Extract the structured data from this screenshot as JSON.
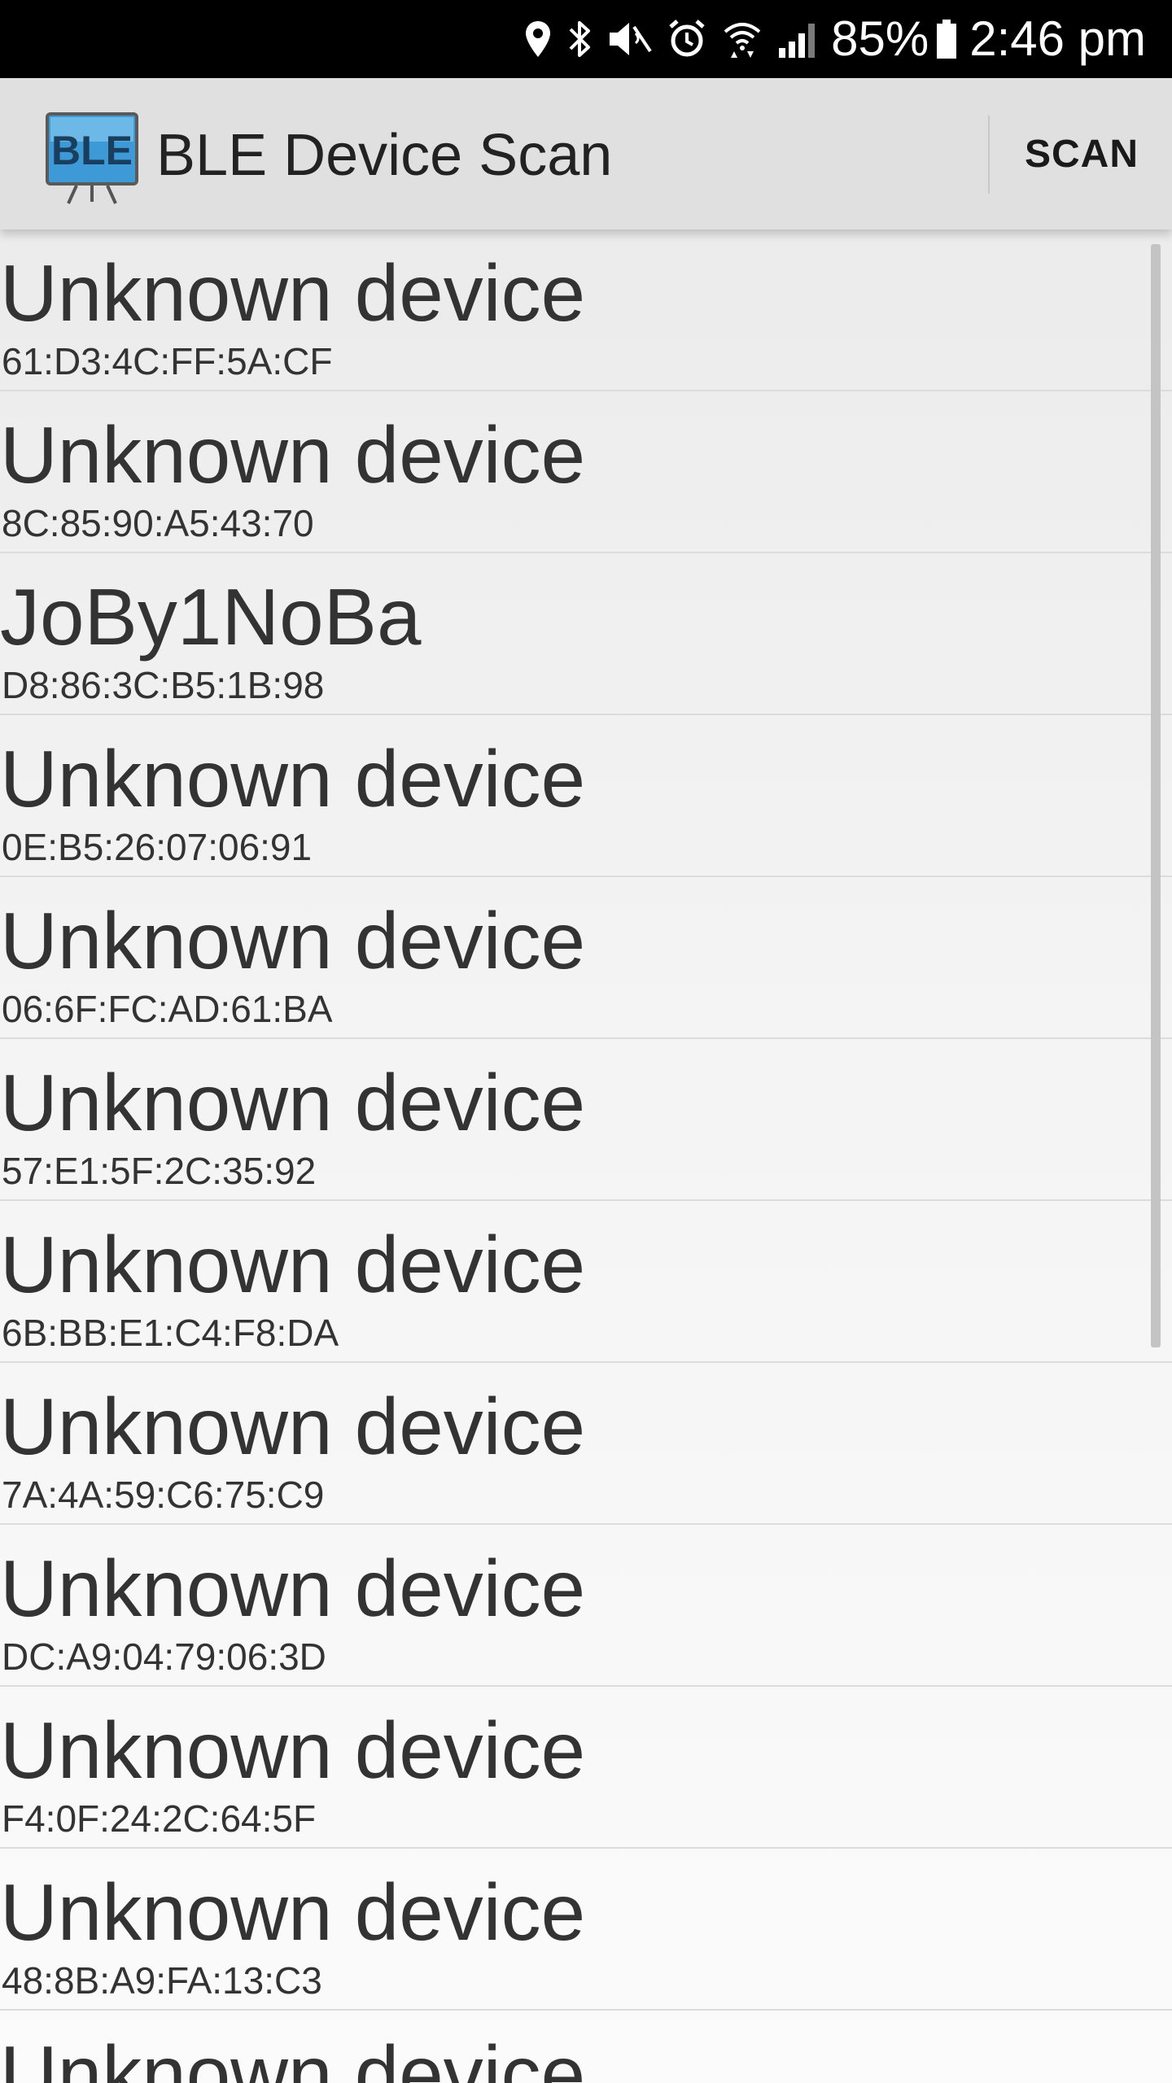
{
  "status_bar": {
    "battery": "85%",
    "time": "2:46 pm",
    "icons": [
      "location-icon",
      "bluetooth-icon",
      "mute-icon",
      "alarm-icon",
      "wifi-icon",
      "signal-icon",
      "battery-icon"
    ]
  },
  "app_bar": {
    "logo_text": "BLE",
    "title": "BLE Device Scan",
    "action_label": "SCAN"
  },
  "devices": [
    {
      "name": "Unknown device",
      "address": "61:D3:4C:FF:5A:CF"
    },
    {
      "name": "Unknown device",
      "address": "8C:85:90:A5:43:70"
    },
    {
      "name": "JoBy1NoBa",
      "address": "D8:86:3C:B5:1B:98"
    },
    {
      "name": "Unknown device",
      "address": "0E:B5:26:07:06:91"
    },
    {
      "name": "Unknown device",
      "address": "06:6F:FC:AD:61:BA"
    },
    {
      "name": "Unknown device",
      "address": "57:E1:5F:2C:35:92"
    },
    {
      "name": "Unknown device",
      "address": "6B:BB:E1:C4:F8:DA"
    },
    {
      "name": "Unknown device",
      "address": "7A:4A:59:C6:75:C9"
    },
    {
      "name": "Unknown device",
      "address": "DC:A9:04:79:06:3D"
    },
    {
      "name": "Unknown device",
      "address": "F4:0F:24:2C:64:5F"
    },
    {
      "name": "Unknown device",
      "address": "48:8B:A9:FA:13:C3"
    },
    {
      "name": "Unknown device",
      "address": ""
    }
  ]
}
